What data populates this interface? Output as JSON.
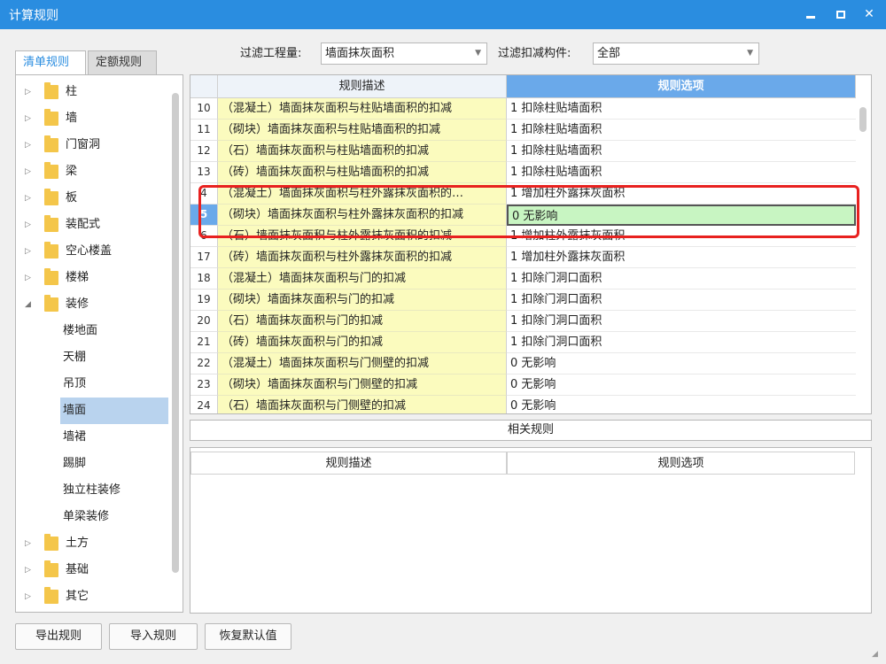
{
  "window": {
    "title": "计算规则",
    "min_icon": "minimize-icon",
    "max_icon": "maximize-icon",
    "close_icon": "close-icon"
  },
  "tabs": [
    {
      "label": "清单规则",
      "active": true
    },
    {
      "label": "定额规则",
      "active": false
    }
  ],
  "filter": {
    "quantity_label": "过滤工程量:",
    "quantity_value": "墙面抹灰面积",
    "component_label": "过滤扣减构件:",
    "component_value": "全部"
  },
  "tree": {
    "items": [
      {
        "label": "柱"
      },
      {
        "label": "墙"
      },
      {
        "label": "门窗洞"
      },
      {
        "label": "梁"
      },
      {
        "label": "板"
      },
      {
        "label": "装配式"
      },
      {
        "label": "空心楼盖"
      },
      {
        "label": "楼梯"
      },
      {
        "label": "装修"
      },
      {
        "label": "土方"
      },
      {
        "label": "基础"
      },
      {
        "label": "其它"
      }
    ],
    "children": [
      {
        "label": "楼地面"
      },
      {
        "label": "天棚"
      },
      {
        "label": "吊顶"
      },
      {
        "label": "墙面",
        "selected": true
      },
      {
        "label": "墙裙"
      },
      {
        "label": "踢脚"
      },
      {
        "label": "独立柱装修"
      },
      {
        "label": "单梁装修"
      }
    ]
  },
  "grid": {
    "headers": {
      "desc": "规则描述",
      "option": "规则选项"
    },
    "rows": [
      {
        "num": "10",
        "desc": "（混凝土）墙面抹灰面积与柱贴墙面积的扣减",
        "option": "1  扣除柱贴墙面积"
      },
      {
        "num": "11",
        "desc": "（砌块）墙面抹灰面积与柱贴墙面积的扣减",
        "option": "1  扣除柱贴墙面积"
      },
      {
        "num": "12",
        "desc": "（石）墙面抹灰面积与柱贴墙面积的扣减",
        "option": "1  扣除柱贴墙面积"
      },
      {
        "num": "13",
        "desc": "（砖）墙面抹灰面积与柱贴墙面积的扣减",
        "option": "1  扣除柱贴墙面积"
      },
      {
        "num": "4",
        "desc": "（混凝土）墙面抹灰面积与柱外露抹灰面积的…",
        "option": "1  增加柱外露抹灰面积"
      },
      {
        "num": "5",
        "desc": "（砌块）墙面抹灰面积与柱外露抹灰面积的扣减",
        "option": "0   无影响"
      },
      {
        "num": "6",
        "desc": "（石）墙面抹灰面积与柱外露抹灰面积的扣减",
        "option": "1  增加柱外露抹灰面积"
      },
      {
        "num": "17",
        "desc": "（砖）墙面抹灰面积与柱外露抹灰面积的扣减",
        "option": "1  增加柱外露抹灰面积"
      },
      {
        "num": "18",
        "desc": "（混凝土）墙面抹灰面积与门的扣减",
        "option": "1  扣除门洞口面积"
      },
      {
        "num": "19",
        "desc": "（砌块）墙面抹灰面积与门的扣减",
        "option": "1  扣除门洞口面积"
      },
      {
        "num": "20",
        "desc": "（石）墙面抹灰面积与门的扣减",
        "option": "1  扣除门洞口面积"
      },
      {
        "num": "21",
        "desc": "（砖）墙面抹灰面积与门的扣减",
        "option": "1  扣除门洞口面积"
      },
      {
        "num": "22",
        "desc": "（混凝土）墙面抹灰面积与门侧壁的扣减",
        "option": "0   无影响"
      },
      {
        "num": "23",
        "desc": "（砌块）墙面抹灰面积与门侧壁的扣减",
        "option": "0   无影响"
      },
      {
        "num": "24",
        "desc": "（石）墙面抹灰面积与门侧壁的扣减",
        "option": "0   无影响"
      }
    ]
  },
  "related": {
    "title": "相关规则",
    "headers": {
      "desc": "规则描述",
      "option": "规则选项"
    }
  },
  "buttons": {
    "export": "导出规则",
    "import": "导入规则",
    "restore": "恢复默认值"
  },
  "colors": {
    "titlebar": "#2a8de0",
    "header_active": "#6aa9ea",
    "desc_cell": "#fbfbbe",
    "selected_cell": "#c8f5c2",
    "highlight_border": "#e8211f",
    "tree_selected": "#b9d3ee"
  }
}
